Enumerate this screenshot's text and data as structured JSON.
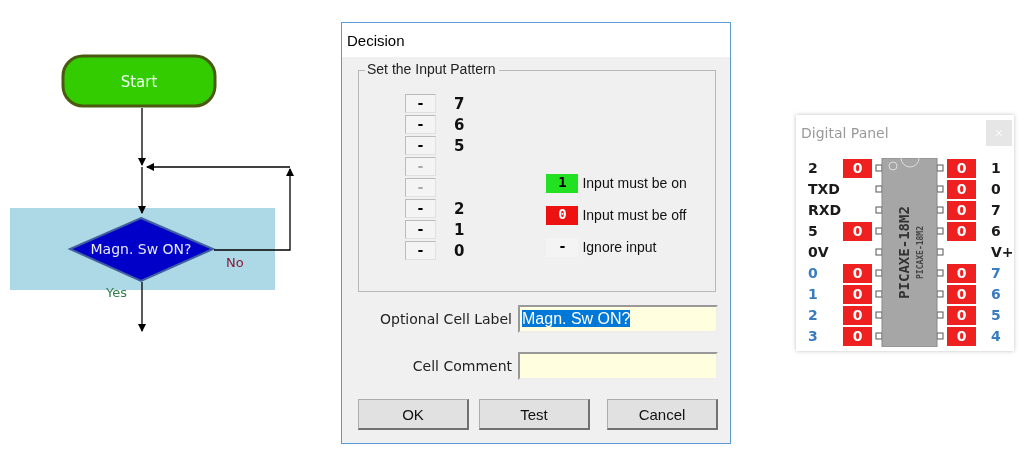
{
  "flowchart": {
    "start": {
      "label": "Start"
    },
    "decision": {
      "label": "Magn. Sw ON?",
      "selected": true,
      "yes_label": "Yes",
      "no_label": "No"
    }
  },
  "dialog": {
    "title": "Decision",
    "group_title": "Set the Input Pattern",
    "pattern": [
      {
        "value": "-",
        "label": "7",
        "disabled": false
      },
      {
        "value": "-",
        "label": "6",
        "disabled": false
      },
      {
        "value": "-",
        "label": "5",
        "disabled": false
      },
      {
        "value": "-",
        "disabled": true
      },
      {
        "value": "-",
        "disabled": true
      },
      {
        "value": "-",
        "label": "2",
        "disabled": false
      },
      {
        "value": "-",
        "label": "1",
        "disabled": false
      },
      {
        "value": "-",
        "label": "0",
        "disabled": false
      }
    ],
    "legend": [
      {
        "value": "1",
        "kind": "on",
        "text": "Input must be on"
      },
      {
        "value": "0",
        "kind": "off",
        "text": "Input must be off"
      },
      {
        "value": "-",
        "kind": "ignore",
        "text": "Ignore input"
      }
    ],
    "fields": [
      {
        "label": "Optional Cell Label",
        "value": "Magn. Sw ON?",
        "text_selected": true
      },
      {
        "label": "Cell Comment"
      }
    ],
    "buttons": [
      "OK",
      "Test",
      "Cancel"
    ]
  },
  "digital_panel": {
    "title": "Digital Panel",
    "chip_label": "PICAXE-18M2",
    "chip_sublabel": "PICAXE-18M2",
    "rows": [
      {
        "left_label": "2",
        "color": "#1a1a1a",
        "left_box": {
          "value": "0",
          "on": false
        },
        "right_box": {
          "value": "0",
          "on": false
        },
        "right_label": "1"
      },
      {
        "left_label": "TXD",
        "color": "#1a1a1a",
        "right_box": {
          "value": "0",
          "on": false
        },
        "right_label": "0"
      },
      {
        "left_label": "RXD",
        "color": "#1a1a1a",
        "right_box": {
          "value": "0",
          "on": false
        },
        "right_label": "7"
      },
      {
        "left_label": "5",
        "color": "#1a1a1a",
        "left_box": {
          "value": "0",
          "on": false
        },
        "right_box": {
          "value": "0",
          "on": false
        },
        "right_label": "6"
      },
      {
        "left_label": "0V",
        "color": "#1a1a1a",
        "right_label": "V+"
      },
      {
        "left_label": "0",
        "color": "#3a7cc0",
        "left_box": {
          "value": "0",
          "on": false
        },
        "right_box": {
          "value": "0",
          "on": false
        },
        "right_label": "7"
      },
      {
        "left_label": "1",
        "color": "#3a7cc0",
        "left_box": {
          "value": "0",
          "on": false
        },
        "right_box": {
          "value": "0",
          "on": false
        },
        "right_label": "6"
      },
      {
        "left_label": "2",
        "color": "#3a7cc0",
        "left_box": {
          "value": "0",
          "on": false
        },
        "right_box": {
          "value": "0",
          "on": false
        },
        "right_label": "5"
      },
      {
        "left_label": "3",
        "color": "#3a7cc0",
        "left_box": {
          "value": "0",
          "on": false
        },
        "right_box": {
          "value": "0",
          "on": false
        },
        "right_label": "4"
      }
    ]
  }
}
